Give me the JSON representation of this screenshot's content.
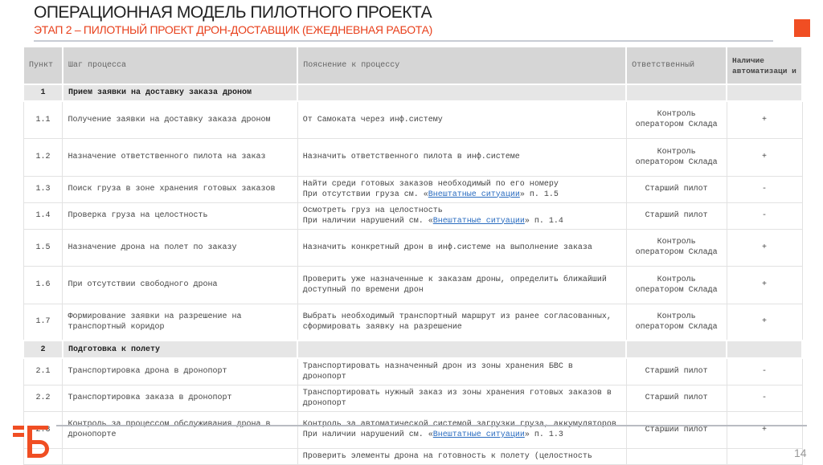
{
  "header": {
    "title": "ОПЕРАЦИОННАЯ МОДЕЛЬ ПИЛОТНОГО ПРОЕКТА",
    "subtitle": "ЭТАП 2 – ПИЛОТНЫЙ ПРОЕКТ ДРОН-ДОСТАВЩИК (ЕЖЕДНЕВНАЯ РАБОТА)"
  },
  "table": {
    "columns": [
      "Пункт",
      "Шаг процесса",
      "Пояснение к процессу",
      "Ответственный",
      "Наличие автоматизаци и"
    ],
    "rows": [
      {
        "type": "sec",
        "num": "1",
        "step": "Прием заявки на доставку заказа дроном"
      },
      {
        "type": "row",
        "num": "1.1",
        "step": "Получение заявки на доставку заказа дроном",
        "desc": [
          "От Самоката через инф.систему"
        ],
        "resp": "Контроль оператором Склада",
        "auto": "+"
      },
      {
        "type": "row",
        "num": "1.2",
        "step": "Назначение ответственного пилота на заказ",
        "desc": [
          "Назначить ответственного пилота в инф.системе"
        ],
        "resp": "Контроль оператором Склада",
        "auto": "+"
      },
      {
        "type": "row",
        "num": "1.3",
        "step": "Поиск груза в зоне хранения готовых заказов",
        "desc": [
          "Найти среди готовых заказов необходимый по его номеру",
          "При отсутствии груза см. «"
        ],
        "link": "Внештатные ситуации",
        "after": "» п. 1.5",
        "resp": "Старший пилот",
        "auto": "-"
      },
      {
        "type": "row",
        "num": "1.4",
        "step": "Проверка груза на целостность",
        "desc": [
          "Осмотреть груз на целостность",
          "При наличии нарушений см. «"
        ],
        "link": "Внештатные ситуации",
        "after": "» п. 1.4",
        "resp": "Старший пилот",
        "auto": "-"
      },
      {
        "type": "row",
        "num": "1.5",
        "step": "Назначение дрона на полет по заказу",
        "desc": [
          "Назначить конкретный дрон в инф.системе на выполнение заказа"
        ],
        "resp": "Контроль оператором Склада",
        "auto": "+"
      },
      {
        "type": "row",
        "num": "1.6",
        "step": "При отсутствии свободного дрона",
        "desc": [
          "Проверить уже назначенные к заказам дроны, определить ближайший доступный по времени дрон"
        ],
        "resp": "Контроль оператором Склада",
        "auto": "+"
      },
      {
        "type": "row",
        "num": "1.7",
        "step": "Формирование заявки на разрешение на транспортный коридор",
        "desc": [
          "Выбрать необходимый транспортный маршрут из ранее согласованных, сформировать заявку на разрешение"
        ],
        "resp": "Контроль оператором Склада",
        "auto": "+"
      },
      {
        "type": "sec",
        "num": "2",
        "step": "Подготовка к полету"
      },
      {
        "type": "row",
        "num": "2.1",
        "step": "Транспортировка дрона в дронопорт",
        "desc": [
          "Транспортировать назначенный дрон из зоны хранения БВС в дронопорт"
        ],
        "resp": "Старший пилот",
        "auto": "-"
      },
      {
        "type": "row",
        "num": "2.2",
        "step": "Транспортировка заказа в дронопорт",
        "desc": [
          "Транспортировать нужный заказ из зоны хранения готовых заказов в дронопорт"
        ],
        "resp": "Старший пилот",
        "auto": "-"
      },
      {
        "type": "row",
        "num": "2.3",
        "step": "Контроль за процессом обслуживания дрона в дронопорте",
        "desc": [
          "Контроль за автоматической системой загрузки груза, аккумуляторов",
          "При наличии нарушений см. «"
        ],
        "link": "Внештатные ситуации",
        "after": "» п. 1.3",
        "resp": "Старший пилот",
        "auto": "+"
      },
      {
        "type": "row",
        "num": "",
        "step": "",
        "desc": [
          "Проверить элементы дрона на готовность к полету (целостность"
        ],
        "resp": "",
        "auto": ""
      }
    ]
  },
  "footer": {
    "page": "14",
    "logo_text": "ГБ"
  },
  "colors": {
    "accent": "#f04e23"
  }
}
